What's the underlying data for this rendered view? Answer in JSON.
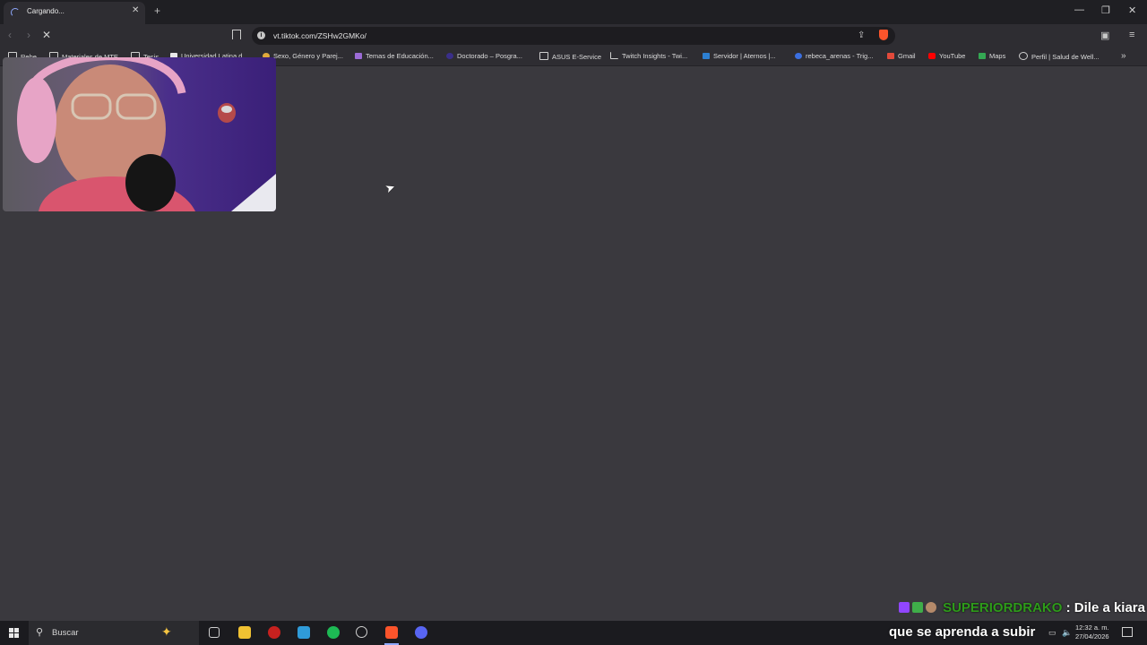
{
  "tab": {
    "title": "Cargando...",
    "close": "✕",
    "new_tab": "+"
  },
  "window": {
    "minimize": "—",
    "restore": "❐",
    "close": "✕"
  },
  "toolbar": {
    "back": "‹",
    "forward": "›",
    "stop": "✕",
    "url": "vt.tiktok.com/ZSHw2GMKo/"
  },
  "bookmarks": [
    {
      "label": "Rebe",
      "icon": "folder-icon"
    },
    {
      "label": "Materiales de MTE",
      "icon": "folder-icon"
    },
    {
      "label": "Tesis",
      "icon": "folder-icon"
    },
    {
      "label": "Universidad Latina d...",
      "icon": "site-icon"
    },
    {
      "label": "Sexo, Género y Parej...",
      "icon": "site-icon"
    },
    {
      "label": "Temas de Educación...",
      "icon": "site-icon"
    },
    {
      "label": "Doctorado – Posgra...",
      "icon": "site-icon"
    },
    {
      "label": "ASUS E-Service",
      "icon": "folder-icon"
    },
    {
      "label": "Twitch Insights - Twi...",
      "icon": "chart-icon"
    },
    {
      "label": "Servidor | Aternos |...",
      "icon": "site-icon"
    },
    {
      "label": "rebeca_arenas - Trig...",
      "icon": "site-icon"
    },
    {
      "label": "Gmail",
      "icon": "gmail-icon"
    },
    {
      "label": "YouTube",
      "icon": "youtube-icon"
    },
    {
      "label": "Maps",
      "icon": "maps-icon"
    },
    {
      "label": "Perfil | Salud de Well...",
      "icon": "globe-icon"
    }
  ],
  "bookmarks_more": "»",
  "chat": {
    "user": "SUPERIORDRAKO",
    "line1": ": Dile a kiara",
    "line2": "que se aprenda a subir"
  },
  "taskbar": {
    "search_placeholder": "Buscar",
    "clock_time": "12:32 a. m.",
    "clock_date": "27/04/2026"
  },
  "colors": {
    "page_bg": "#3a393e",
    "chat_user": "#2e9b1a",
    "brave_orange": "#fb542b",
    "loading_accent": "#8fa9ff"
  }
}
